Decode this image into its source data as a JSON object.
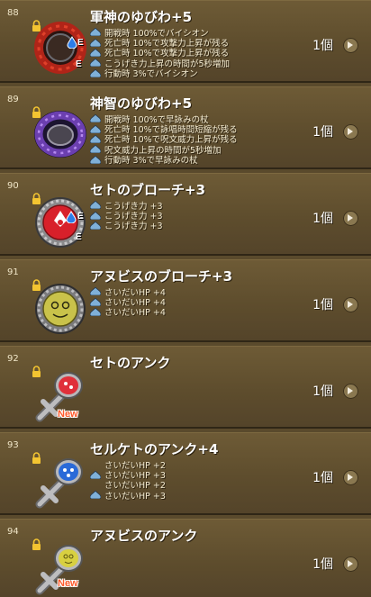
{
  "items": [
    {
      "number": "88",
      "name": "軍神のゆびわ+5",
      "quantity": "1個",
      "ring": "red",
      "badges": [
        "E",
        "E"
      ],
      "details": [
        "開戦時 100%でバイシオン",
        "死亡時 10%で攻撃力上昇が残る",
        "死亡時 10%で攻撃力上昇が残る",
        "こうげき力上昇の時間が5秒増加",
        "行動時 3%でバイシオン"
      ]
    },
    {
      "number": "89",
      "name": "神智のゆびわ+5",
      "quantity": "1個",
      "ring": "purple",
      "badges": [],
      "details": [
        "開戦時 100%で早詠みの杖",
        "死亡時 10%で詠唱時間短縮が残る",
        "死亡時 10%で呪文威力上昇が残る",
        "呪文威力上昇の時間が5秒増加",
        "行動時 3%で早詠みの杖"
      ]
    },
    {
      "number": "90",
      "name": "セトのブローチ+3",
      "quantity": "1個",
      "badges": [
        "E",
        "E"
      ],
      "details": [
        "こうげき力 +3",
        "こうげき力 +3",
        "こうげき力 +3"
      ]
    },
    {
      "number": "91",
      "name": "アヌビスのブローチ+3",
      "quantity": "1個",
      "badges": [],
      "details": [
        "さいだいHP +4",
        "さいだいHP +4",
        "さいだいHP +4"
      ]
    },
    {
      "number": "92",
      "name": "セトのアンク",
      "quantity": "1個",
      "new_label": "New",
      "details": []
    },
    {
      "number": "93",
      "name": "セルケトのアンク+4",
      "quantity": "1個",
      "details": [
        "さいだいHP +2",
        "さいだいHP +3",
        "さいだいHP +2",
        "さいだいHP +3"
      ]
    },
    {
      "number": "94",
      "name": "アヌビスのアンク",
      "quantity": "1個",
      "new_label": "New",
      "details": []
    }
  ],
  "icons": {
    "lock": "lock-icon",
    "detail_bullet": "slime-bullet-icon",
    "detail_arrow": "chevron-right-icon"
  },
  "colors": {
    "background": "#5a4a2c",
    "name_text": "#ffffff",
    "new_badge": "#ff5a2b"
  }
}
